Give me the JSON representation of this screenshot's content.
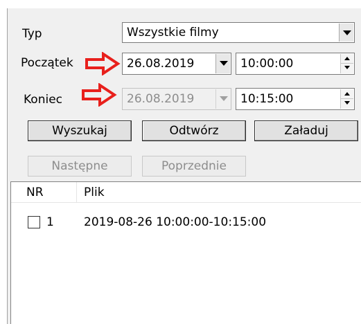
{
  "form": {
    "type_label": "Typ",
    "type_value": "Wszystkie filmy",
    "start_label": "Początek",
    "start_date": "26.08.2019",
    "start_time": "10:00:00",
    "end_label": "Koniec",
    "end_date": "26.08.2019",
    "end_time": "10:15:00"
  },
  "buttons": {
    "search": "Wyszukaj",
    "play": "Odtwórz",
    "load": "Załaduj",
    "next": "Następne",
    "previous": "Poprzednie"
  },
  "list": {
    "columns": [
      "NR",
      "Plik"
    ],
    "rows": [
      {
        "nr": "1",
        "file": "2019-08-26 10:00:00-10:15:00",
        "checked": false
      }
    ]
  },
  "colors": {
    "annotation_arrow": "#e8201c",
    "panel_bg": "#f0f0f0"
  }
}
